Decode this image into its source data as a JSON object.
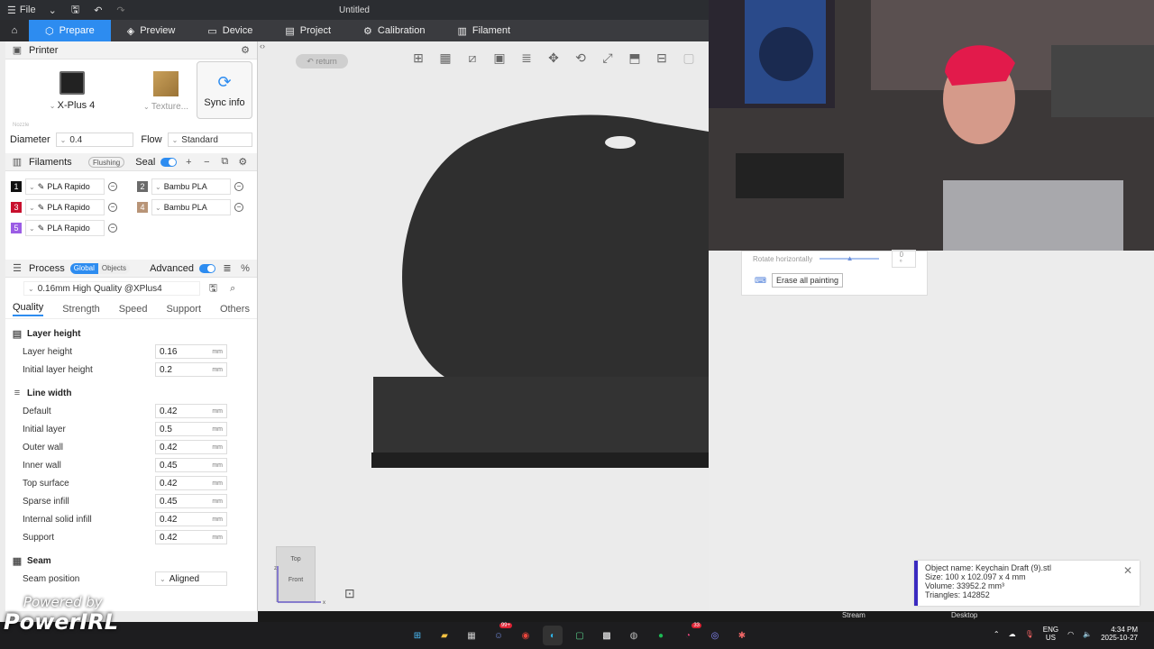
{
  "window": {
    "title": "Untitled",
    "file_menu": "File"
  },
  "nav": {
    "tabs": [
      {
        "label": "Prepare",
        "icon": "cube-icon",
        "active": true
      },
      {
        "label": "Preview",
        "icon": "layers-icon"
      },
      {
        "label": "Device",
        "icon": "device-icon"
      },
      {
        "label": "Project",
        "icon": "project-icon"
      },
      {
        "label": "Calibration",
        "icon": "calibration-icon"
      },
      {
        "label": "Filament",
        "icon": "filament-icon"
      }
    ]
  },
  "printer": {
    "section_title": "Printer",
    "name": "X-Plus 4",
    "plate": "Texture...",
    "sync_label": "Sync info",
    "nozzle_label": "Nozzle",
    "diameter_label": "Diameter",
    "diameter_value": "0.4",
    "flow_label": "Flow",
    "flow_value": "Standard"
  },
  "filaments": {
    "section_title": "Filaments",
    "flushing_label": "Flushing",
    "seal_label": "Seal",
    "items": [
      {
        "num": "1",
        "color": "#111111",
        "name": "PLA Rapido"
      },
      {
        "num": "2",
        "color": "#6b6b6b",
        "name": "Bambu PLA"
      },
      {
        "num": "3",
        "color": "#c8102e",
        "name": "PLA Rapido"
      },
      {
        "num": "4",
        "color": "#b89477",
        "name": "Bambu PLA"
      },
      {
        "num": "5",
        "color": "#9b5de5",
        "name": "PLA Rapido"
      }
    ]
  },
  "process": {
    "section_title": "Process",
    "global_label": "Global",
    "objects_label": "Objects",
    "advanced_label": "Advanced",
    "preset": "0.16mm High Quality @XPlus4",
    "tabs": [
      "Quality",
      "Strength",
      "Speed",
      "Support",
      "Others"
    ],
    "groups": {
      "layer_height": {
        "title": "Layer height",
        "params": [
          {
            "label": "Layer height",
            "value": "0.16",
            "unit": "mm"
          },
          {
            "label": "Initial layer height",
            "value": "0.2",
            "unit": "mm"
          }
        ]
      },
      "line_width": {
        "title": "Line width",
        "params": [
          {
            "label": "Default",
            "value": "0.42",
            "unit": "mm"
          },
          {
            "label": "Initial layer",
            "value": "0.5",
            "unit": "mm"
          },
          {
            "label": "Outer wall",
            "value": "0.42",
            "unit": "mm"
          },
          {
            "label": "Inner wall",
            "value": "0.45",
            "unit": "mm"
          },
          {
            "label": "Top surface",
            "value": "0.42",
            "unit": "mm"
          },
          {
            "label": "Sparse infill",
            "value": "0.45",
            "unit": "mm"
          },
          {
            "label": "Internal solid infill",
            "value": "0.42",
            "unit": "mm"
          },
          {
            "label": "Support",
            "value": "0.42",
            "unit": "mm"
          }
        ]
      },
      "seam": {
        "title": "Seam",
        "params": [
          {
            "label": "Seam position",
            "value": "Aligned"
          }
        ]
      }
    }
  },
  "viewport": {
    "return_label": "return",
    "viewcube_top": "Top",
    "viewcube_front": "Front",
    "axis_x": "x",
    "axis_z": "z"
  },
  "paint_panel": {
    "rotate_label": "Rotate horizontally",
    "rotate_value": "0 °",
    "erase_label": "Erase all painting"
  },
  "object_info": {
    "name": "Object name: Keychain Draft (9).stl",
    "size": "Size: 100 x 102.097 x 4 mm",
    "volume": "Volume: 33952.2 mm³",
    "triangles": "Triangles: 142852"
  },
  "overlay": {
    "stream_label": "Stream",
    "desktop_label": "Desktop",
    "watermark_small": "Powered by",
    "watermark_big": "PowerIRL"
  },
  "taskbar": {
    "lang_1": "ENG",
    "lang_2": "US",
    "time": "4:34 PM",
    "date": "2025-10-27",
    "badge_1": "99+",
    "badge_2": "33"
  },
  "colors": {
    "accent": "#2d8cf0",
    "object": "#2f2f2f",
    "info_border": "#3a2ac0"
  }
}
